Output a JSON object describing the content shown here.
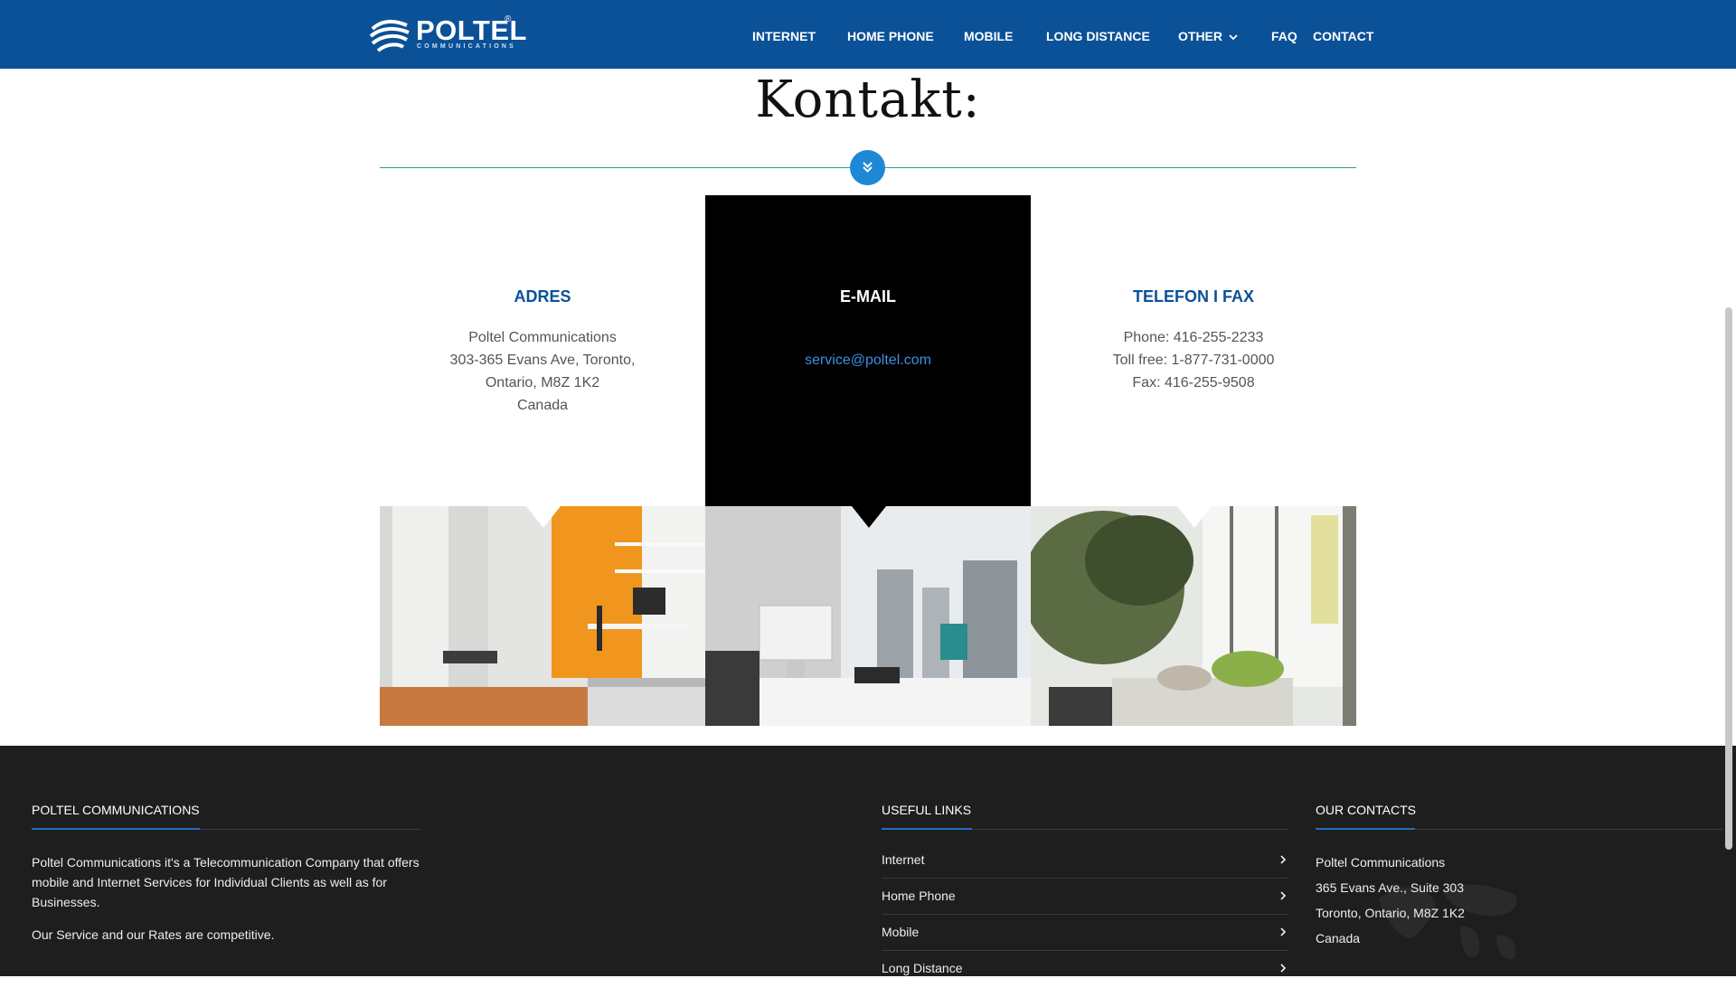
{
  "brand": {
    "name": "POLTEL",
    "registered_mark": "®",
    "tagline": "COMMUNICATIONS",
    "primary_color": "#0b5198",
    "accent_color": "#1e88d6"
  },
  "nav": {
    "items": [
      {
        "label": "INTERNET"
      },
      {
        "label": "HOME PHONE"
      },
      {
        "label": "MOBILE"
      },
      {
        "label": "LONG DISTANCE"
      },
      {
        "label": "OTHER",
        "has_dropdown": true
      },
      {
        "label": "FAQ"
      },
      {
        "label": "CONTACT"
      }
    ]
  },
  "contact": {
    "title": "Kontakt:",
    "columns": [
      {
        "heading": "ADRES",
        "lines": [
          "Poltel Communications",
          "303-365 Evans Ave, Toronto,",
          "Ontario, M8Z 1K2",
          "Canada"
        ]
      },
      {
        "heading": "E-MAIL",
        "lines": [
          "service@poltel.com"
        ]
      },
      {
        "heading": "TELEFON I FAX",
        "lines": [
          "Phone: 416-255-2233",
          "Toll free: 1-877-731-0000",
          "Fax: 416-255-9508"
        ]
      }
    ],
    "photos": [
      {
        "icon": "bedroom-office-photo"
      },
      {
        "icon": "desk-office-photo"
      },
      {
        "icon": "window-plant-photo"
      }
    ]
  },
  "footer": {
    "about": {
      "heading": "POLTEL COMMUNICATIONS",
      "text1": "Poltel Communications it's a Telecommunication Company that offers mobile and Internet Services for Individual Clients as well as for Businesses.",
      "text2": "Our Service and our Rates are competitive."
    },
    "links": {
      "heading": "USEFUL LINKS",
      "items": [
        "Internet",
        "Home Phone",
        "Mobile",
        "Long Distance"
      ]
    },
    "contacts": {
      "heading": "OUR CONTACTS",
      "lines": [
        "Poltel Communications",
        "365 Evans Ave., Suite 303",
        "Toronto, Ontario, M8Z 1K2",
        "Canada"
      ]
    }
  }
}
